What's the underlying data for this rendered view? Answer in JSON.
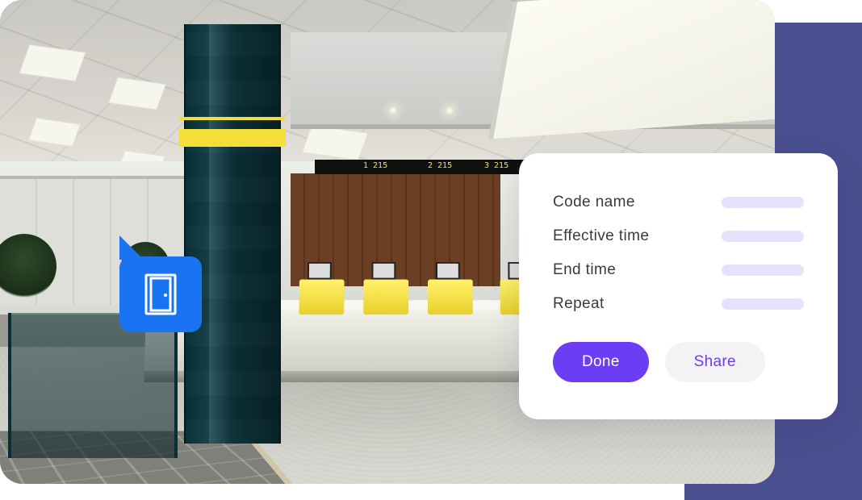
{
  "card": {
    "fields": [
      {
        "label": "Code name"
      },
      {
        "label": "Effective time"
      },
      {
        "label": "End time"
      },
      {
        "label": "Repeat"
      }
    ],
    "actions": {
      "primary": "Done",
      "secondary": "Share"
    }
  },
  "marker": {
    "icon": "door-icon"
  },
  "signage": {
    "n1": "1 215",
    "n2": "2 215",
    "n3": "3 215"
  }
}
